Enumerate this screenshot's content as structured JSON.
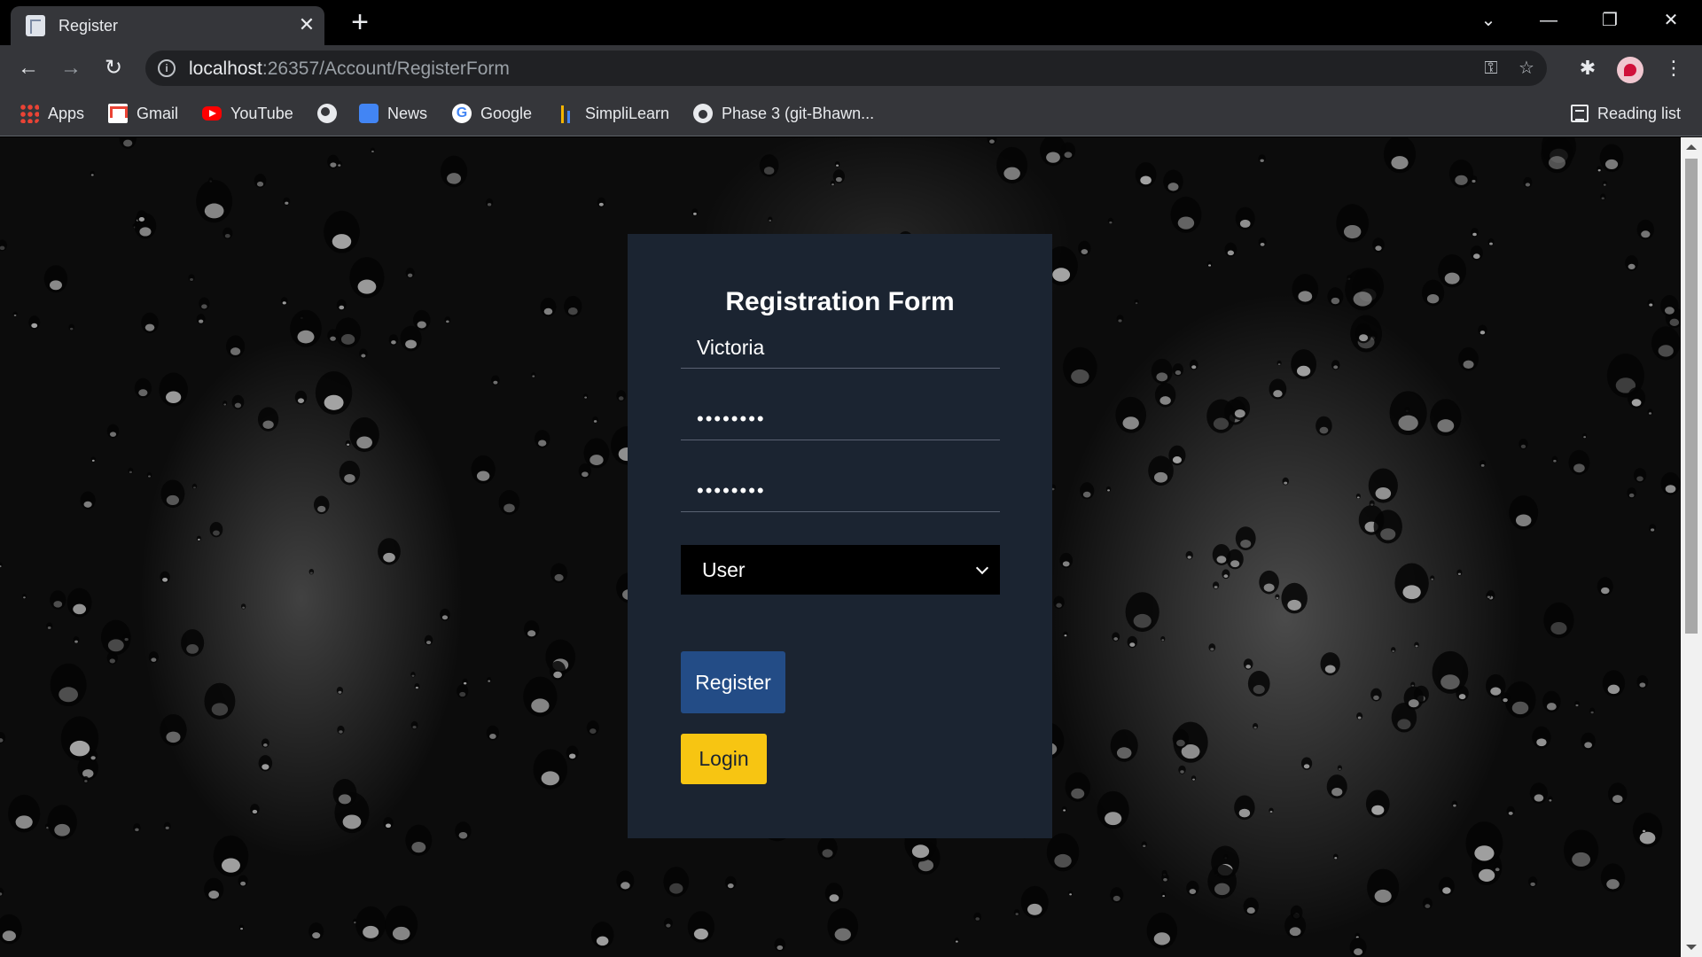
{
  "browser": {
    "tab_title": "Register",
    "tab_close": "✕",
    "new_tab": "+",
    "url_host": "localhost",
    "url_rest": ":26357/Account/RegisterForm",
    "window_controls": {
      "tab_search": "⌄",
      "minimize": "—",
      "restore": "❐",
      "close": "✕"
    },
    "nav": {
      "back": "←",
      "forward": "→",
      "reload": "↻"
    },
    "omnibox_icons": {
      "info": "i",
      "key": "⚿",
      "star": "☆"
    },
    "toolbar_icons": {
      "extensions": "✱",
      "menu": "⋮"
    }
  },
  "bookmarks": {
    "items": [
      {
        "label": "Apps",
        "icon": "apps-icon"
      },
      {
        "label": "Gmail",
        "icon": "gmail-icon"
      },
      {
        "label": "YouTube",
        "icon": "youtube-icon"
      },
      {
        "label": "",
        "icon": "globe-icon"
      },
      {
        "label": "News",
        "icon": "news-icon"
      },
      {
        "label": "Google",
        "icon": "google-icon"
      },
      {
        "label": "SimpliLearn",
        "icon": "simplilearn-icon"
      },
      {
        "label": "Phase 3 (git-Bhawn...",
        "icon": "github-icon"
      }
    ],
    "reading_list": "Reading list"
  },
  "form": {
    "title": "Registration Form",
    "username_value": "Victoria",
    "password_value": "••••••••",
    "confirm_password_value": "••••••••",
    "role_selected": "User",
    "register_label": "Register",
    "login_label": "Login"
  },
  "colors": {
    "card_bg": "#1b2431",
    "register_btn": "#234c86",
    "login_btn": "#f7c512",
    "chrome_dark": "#35363a"
  }
}
